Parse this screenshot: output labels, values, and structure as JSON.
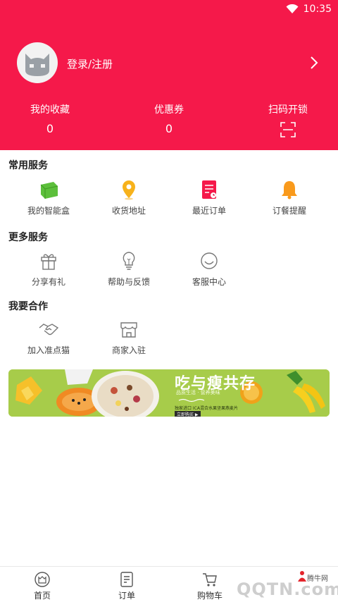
{
  "status_bar": {
    "time": "10:35"
  },
  "profile": {
    "login_label": "登录/注册"
  },
  "stats": [
    {
      "label": "我的收藏",
      "value": "0"
    },
    {
      "label": "优惠券",
      "value": "0"
    },
    {
      "label": "扫码开锁"
    }
  ],
  "sections": {
    "common": {
      "title": "常用服务",
      "items": [
        {
          "label": "我的智能盒",
          "icon": "smart-box-icon"
        },
        {
          "label": "收货地址",
          "icon": "location-pin-icon"
        },
        {
          "label": "最近订单",
          "icon": "order-list-icon"
        },
        {
          "label": "订餐提醒",
          "icon": "bell-icon"
        }
      ]
    },
    "more": {
      "title": "更多服务",
      "items": [
        {
          "label": "分享有礼",
          "icon": "gift-icon"
        },
        {
          "label": "帮助与反馈",
          "icon": "lightbulb-icon"
        },
        {
          "label": "客服中心",
          "icon": "smile-icon"
        }
      ]
    },
    "partner": {
      "title": "我要合作",
      "items": [
        {
          "label": "加入准点猫",
          "icon": "handshake-icon"
        },
        {
          "label": "商家入驻",
          "icon": "store-icon"
        }
      ]
    }
  },
  "banner": {
    "title": "吃与瘦共存",
    "subtitle": "品质生活 · 营养美味",
    "line": "独家进口 ICA混合水果坚果燕麦片",
    "button": "立即购买 ▶"
  },
  "tabbar": [
    {
      "label": "首页",
      "icon": "home-icon"
    },
    {
      "label": "订单",
      "icon": "order-icon"
    },
    {
      "label": "购物车",
      "icon": "cart-icon"
    }
  ],
  "watermark": {
    "text": "QQTN.com",
    "brand": "腾牛网"
  },
  "colors": {
    "primary": "#f5194a",
    "banner": "#a7cc4a"
  }
}
